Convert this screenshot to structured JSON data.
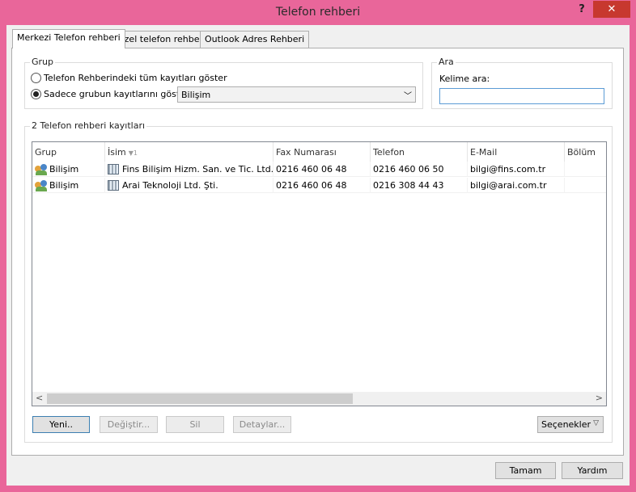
{
  "window": {
    "title": "Telefon rehberi",
    "help_label": "?",
    "close_label": "✕"
  },
  "tabs": [
    {
      "label": "Merkezi Telefon rehberi",
      "active": true
    },
    {
      "label": "Özel telefon rehberi",
      "active": false
    },
    {
      "label": "Outlook Adres Rehberi",
      "active": false
    }
  ],
  "grup": {
    "legend": "Grup",
    "radio_all": "Telefon Rehberindeki tüm kayıtları göster",
    "radio_group": "Sadece grubun kayıtlarını göster",
    "selected_group": "Bilişim"
  },
  "ara": {
    "legend": "Ara",
    "label": "Kelime ara:",
    "value": ""
  },
  "records": {
    "legend": "2 Telefon rehberi kayıtları",
    "columns": [
      "Grup",
      "İsim",
      "Fax Numarası",
      "Telefon",
      "E-Mail",
      "Bölüm"
    ],
    "sort_indicator": "▼1",
    "rows": [
      {
        "grup": "Bilişim",
        "isim": "Fins Bilişim Hizm. San. ve Tic. Ltd. Şti.",
        "fax": "0216 460 06 48",
        "telefon": "0216 460 06 50",
        "email": "bilgi@fins.com.tr",
        "bolum": ""
      },
      {
        "grup": "Bilişim",
        "isim": "Arai Teknoloji Ltd. Şti.",
        "fax": "0216 460 06 48",
        "telefon": "0216 308 44 43",
        "email": "bilgi@arai.com.tr",
        "bolum": ""
      }
    ]
  },
  "buttons": {
    "yeni": "Yeni..",
    "degistir": "Değiştir...",
    "sil": "Sil",
    "detaylar": "Detaylar...",
    "secenekler": "Seçenekler",
    "tamam": "Tamam",
    "yardim": "Yardım"
  }
}
